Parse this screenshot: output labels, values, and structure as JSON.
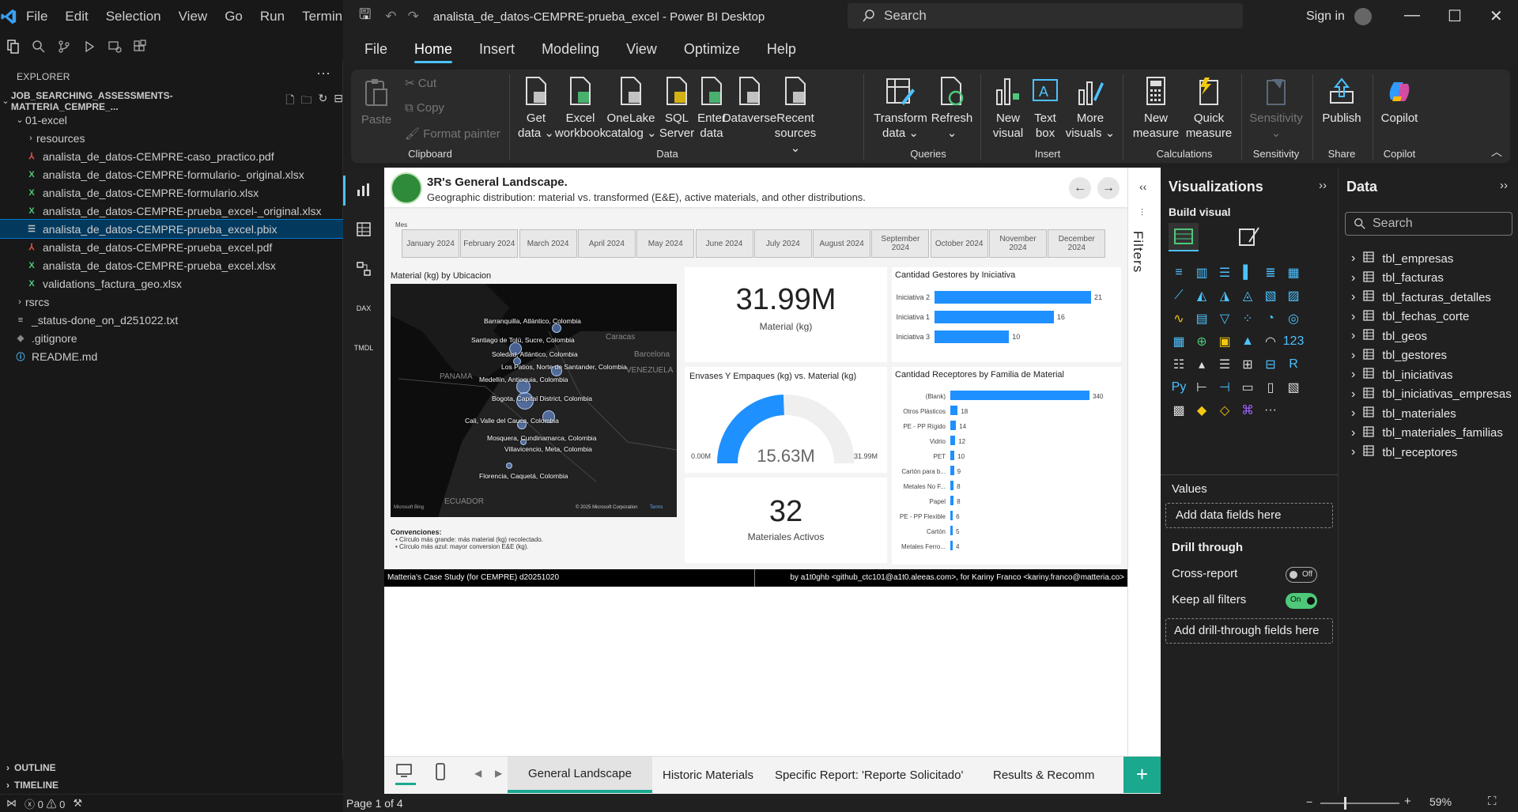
{
  "vscode": {
    "menu": [
      "File",
      "Edit",
      "Selection",
      "View",
      "Go",
      "Run",
      "Terminal"
    ],
    "explorer_title": "EXPLORER",
    "workspace": "JOB_SEARCHING_ASSESSMENTS-MATTERIA_CEMPRE_...",
    "tree": [
      {
        "label": "01-excel",
        "type": "folder-open",
        "indent": 1
      },
      {
        "label": "resources",
        "type": "folder",
        "indent": 2
      },
      {
        "label": "analista_de_datos-CEMPRE-caso_practico.pdf",
        "type": "pdf",
        "indent": 2
      },
      {
        "label": "analista_de_datos-CEMPRE-formulario-_original.xlsx",
        "type": "xlsx",
        "indent": 2
      },
      {
        "label": "analista_de_datos-CEMPRE-formulario.xlsx",
        "type": "xlsx",
        "indent": 2
      },
      {
        "label": "analista_de_datos-CEMPRE-prueba_excel-_original.xlsx",
        "type": "xlsx",
        "indent": 2
      },
      {
        "label": "analista_de_datos-CEMPRE-prueba_excel.pbix",
        "type": "pbix",
        "indent": 2,
        "selected": true
      },
      {
        "label": "analista_de_datos-CEMPRE-prueba_excel.pdf",
        "type": "pdf",
        "indent": 2
      },
      {
        "label": "analista_de_datos-CEMPRE-prueba_excel.xlsx",
        "type": "xlsx",
        "indent": 2
      },
      {
        "label": "validations_factura_geo.xlsx",
        "type": "xlsx",
        "indent": 2
      },
      {
        "label": "rsrcs",
        "type": "folder",
        "indent": 1
      },
      {
        "label": "_status-done_on_d251022.txt",
        "type": "txt",
        "indent": 1
      },
      {
        "label": ".gitignore",
        "type": "git",
        "indent": 1
      },
      {
        "label": "README.md",
        "type": "info",
        "indent": 1
      }
    ],
    "outline": "OUTLINE",
    "timeline": "TIMELINE",
    "status_errors": "0",
    "status_warnings": "0"
  },
  "pbi": {
    "doc_title": "analista_de_datos-CEMPRE-prueba_excel - Power BI Desktop",
    "search": "Search",
    "sign_in": "Sign in",
    "tabs": [
      "File",
      "Home",
      "Insert",
      "Modeling",
      "View",
      "Optimize",
      "Help"
    ],
    "active_tab": "Home",
    "clipboard": {
      "paste": "Paste",
      "cut": "Cut",
      "copy": "Copy",
      "format_painter": "Format painter",
      "label": "Clipboard"
    },
    "data_group": {
      "label": "Data",
      "buttons": [
        {
          "l1": "Get",
          "l2": "data ⌄"
        },
        {
          "l1": "Excel",
          "l2": "workbook"
        },
        {
          "l1": "OneLake",
          "l2": "catalog ⌄"
        },
        {
          "l1": "SQL",
          "l2": "Server"
        },
        {
          "l1": "Enter",
          "l2": "data"
        },
        {
          "l1": "Dataverse",
          "l2": ""
        },
        {
          "l1": "Recent",
          "l2": "sources ⌄"
        }
      ]
    },
    "queries_group": {
      "label": "Queries",
      "transform_1": "Transform",
      "transform_2": "data ⌄",
      "refresh_1": "Refresh",
      "refresh_2": "⌄"
    },
    "insert_group": {
      "label": "Insert",
      "new_visual_1": "New",
      "new_visual_2": "visual",
      "text_box_1": "Text",
      "text_box_2": "box",
      "more_visuals_1": "More",
      "more_visuals_2": "visuals ⌄"
    },
    "calc_group": {
      "label": "Calculations",
      "new_measure_1": "New",
      "new_measure_2": "measure",
      "quick_measure_1": "Quick",
      "quick_measure_2": "measure"
    },
    "sensitivity_group": {
      "label": "Sensitivity",
      "btn_1": "Sensitivity",
      "btn_2": "⌄"
    },
    "share_group": {
      "label": "Share",
      "publish": "Publish"
    },
    "copilot_group": {
      "label": "Copilot",
      "copilot": "Copilot"
    },
    "filters_label": "Filters",
    "page_tabs": [
      "General Landscape",
      "Historic Materials",
      "Specific Report: 'Reporte Solicitado'",
      "Results & Recomm"
    ],
    "active_page": "General Landscape",
    "page_indicator": "Page 1 of 4",
    "zoom": "59%"
  },
  "report": {
    "title": "3R's General Landscape.",
    "subtitle": "Geographic distribution: material vs. transformed (E&E), active materials, and other distributions.",
    "slicer_label": "Mes",
    "months": [
      "January 2024",
      "February 2024",
      "March 2024",
      "April 2024",
      "May 2024",
      "June 2024",
      "July 2024",
      "August 2024",
      "September 2024",
      "October 2024",
      "November 2024",
      "December 2024"
    ],
    "map_title": "Material (kg) by Ubicacion",
    "map_cities": [
      "Barranquilla, Atlántico, Colombia",
      "Santiago de Tolú, Sucre, Colombia",
      "Soledad, Atlántico, Colombia",
      "Los Patios, Norte de Santander, Colombia",
      "Medellín, Antioquia, Colombia",
      "Bogota, Capital District, Colombia",
      "Cali, Valle del Cauca, Colombia",
      "Mosquera, Cundinamarca, Colombia",
      "Villavicencio, Meta, Colombia",
      "Florencia, Caquetá, Colombia"
    ],
    "map_places": [
      "Caracas",
      "Barcelona",
      "VENEZUELA",
      "PANAMA",
      "ECUADOR"
    ],
    "map_credit": "© 2025 Microsoft Corporation",
    "map_terms": "Terms",
    "map_logo": "Microsoft Bing",
    "card_material_value": "31.99M",
    "card_material_label": "Material (kg)",
    "gauge_title": "Envases Y Empaques (kg) vs. Material (kg)",
    "gauge_value": "15.63M",
    "gauge_min": "0.00M",
    "gauge_max": "31.99M",
    "gauge_fraction": 0.4886,
    "card_active_value": "32",
    "card_active_label": "Materiales Activos",
    "conventions_title": "Convenciones:",
    "conventions": [
      "• Círculo más grande: más material (kg) recolectado.",
      "• Círculo más azul: mayor conversion E&E (kg)."
    ],
    "gestores_title": "Cantidad Gestores by Iniciativa",
    "receptores_title": "Cantidad Receptores by Familia de Material",
    "footer_left": "Matteria's Case Study (for CEMPRE) d20251020",
    "footer_right": "by a1t0ghb <github_ctc101@a1t0.aleeas.com>, for Kariny Franco <kariny.franco@matteria.co>"
  },
  "chart_data": [
    {
      "type": "bar",
      "title": "Cantidad Gestores by Iniciativa",
      "categories": [
        "Iniciativa 2",
        "Iniciativa 1",
        "Iniciativa 3"
      ],
      "values": [
        21,
        16,
        10
      ]
    },
    {
      "type": "bar",
      "title": "Cantidad Receptores by Familia de Material",
      "categories": [
        "(Blank)",
        "Otros Plásticos",
        "PE - PP Rígido",
        "Vidrio",
        "PET",
        "Cartón para b...",
        "Metales No F...",
        "Papel",
        "PE - PP Flexible",
        "Cartón",
        "Metales Ferro..."
      ],
      "values": [
        340,
        18,
        14,
        12,
        10,
        9,
        8,
        8,
        6,
        5,
        4
      ]
    }
  ],
  "viz_pane": {
    "title": "Visualizations",
    "build_visual": "Build visual",
    "values": "Values",
    "add_data": "Add data fields here",
    "drill_through": "Drill through",
    "cross_report": "Cross-report",
    "cross_report_state": "Off",
    "keep_filters": "Keep all filters",
    "keep_filters_state": "On",
    "add_drill": "Add drill-through fields here"
  },
  "data_pane": {
    "title": "Data",
    "search": "Search",
    "tables": [
      "tbl_empresas",
      "tbl_facturas",
      "tbl_facturas_detalles",
      "tbl_fechas_corte",
      "tbl_geos",
      "tbl_gestores",
      "tbl_iniciativas",
      "tbl_iniciativas_empresas",
      "tbl_materiales",
      "tbl_materiales_familias",
      "tbl_receptores"
    ]
  }
}
